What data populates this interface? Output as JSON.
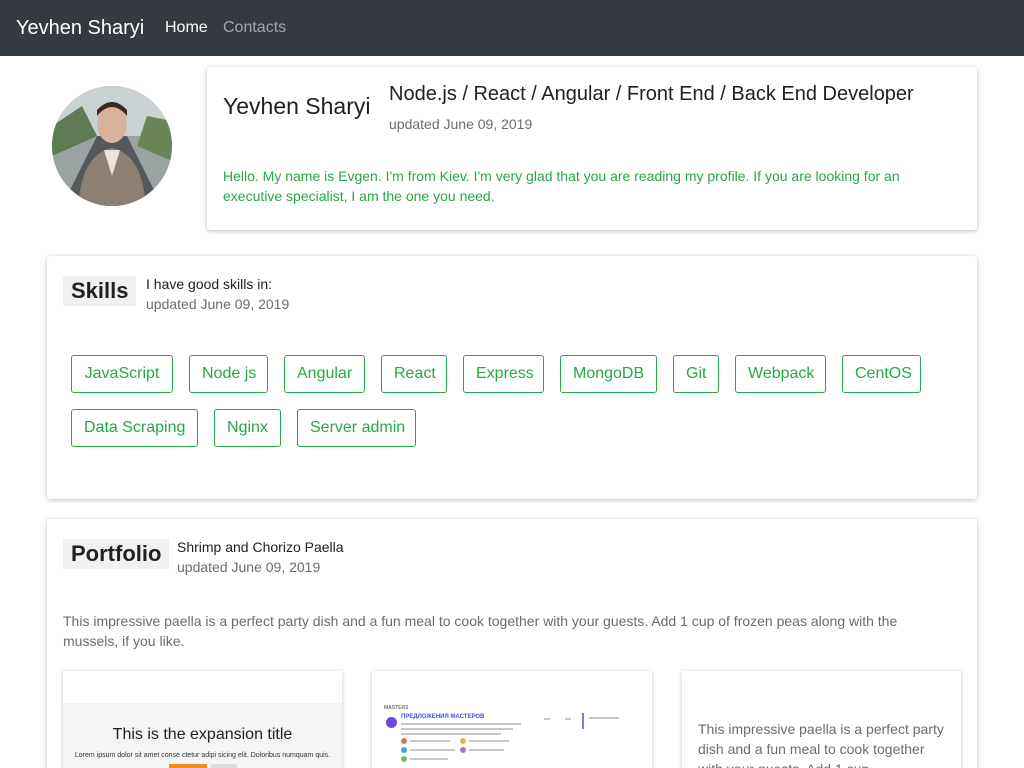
{
  "nav": {
    "brand": "Yevhen Sharyi",
    "links": [
      {
        "label": "Home",
        "active": true
      },
      {
        "label": "Contacts",
        "active": false
      }
    ],
    "background": "#343a40"
  },
  "profile": {
    "name": "Yevhen Sharyi",
    "title": "Node.js / React / Angular / Front End / Back End Developer",
    "updated": "updated June 09, 2019",
    "bio": "Hello. My name is Evgen. I'm from Kiev. I'm very glad that you are reading my profile. If you are looking for an executive specialist, I am the one you need."
  },
  "skills": {
    "heading": "Skills",
    "subtitle": "I have good skills in:",
    "updated": "updated June 09, 2019",
    "items": [
      "JavaScript",
      "Node js",
      "Angular",
      "React",
      "Express",
      "MongoDB",
      "Git",
      "Webpack",
      "CentOS",
      "Data Scraping",
      "Nginx",
      "Server admin"
    ],
    "accent": "#28a745"
  },
  "portfolio": {
    "heading": "Portfolio",
    "subtitle": "Shrimp and Chorizo Paella",
    "updated": "updated June 09, 2019",
    "description": "This impressive paella is a perfect party dish and a fun meal to cook together with your guests. Add 1 cup of frozen peas along with the mussels, if you like.",
    "items": [
      {
        "title": "This is the expansion title",
        "lorem": "Lorem ipsum dolor sit amet conse ctetur adipi sicing elit. Doloribus numquam quis."
      },
      {
        "title": "ПРЕДЛОЖЕНИЯ МАСТЕРОВ"
      },
      {
        "text": "This impressive paella is a perfect party dish and a fun meal to cook together with your guests. Add 1 cup"
      }
    ]
  }
}
